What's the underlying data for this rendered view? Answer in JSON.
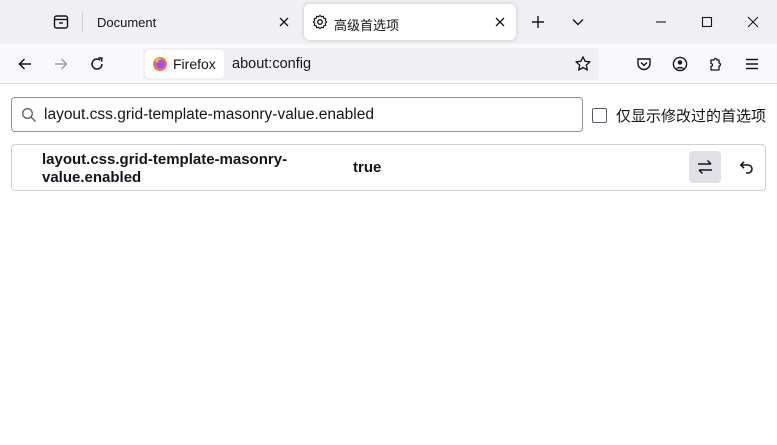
{
  "tabs": [
    {
      "label": "Document",
      "active": false
    },
    {
      "label": "高级首选项",
      "active": true
    }
  ],
  "navbar": {
    "identity_label": "Firefox",
    "url": "about:config"
  },
  "search": {
    "value": "layout.css.grid-template-masonry-value.enabled"
  },
  "filter": {
    "modified_only_label": "仅显示修改过的首选项",
    "checked": false
  },
  "preferences": [
    {
      "name": "layout.css.grid-template-masonry-value.enabled",
      "name_line1": "layout.css.grid-template-masonry-",
      "name_line2": "value.enabled",
      "value": "true"
    }
  ],
  "colors": {
    "tabstrip_bg": "#f0f0f4",
    "navbar_bg": "#f9f9fb",
    "text": "#15141a",
    "firefox_orange": "#ff7139",
    "firefox_purple": "#9059ff"
  },
  "icons": {
    "firefox_view": "firefox-view-icon",
    "new_tab": "plus-icon",
    "list_all_tabs": "chevron-down-icon",
    "minimize": "minimize-icon",
    "maximize": "maximize-icon",
    "close_window": "close-icon",
    "back": "arrow-left-icon",
    "forward": "arrow-right-icon",
    "reload": "reload-icon",
    "bookmark": "star-icon",
    "pocket": "pocket-icon",
    "account": "account-icon",
    "extensions": "puzzle-icon",
    "menu": "hamburger-icon",
    "toggle": "toggle-icon",
    "reset": "undo-icon"
  }
}
